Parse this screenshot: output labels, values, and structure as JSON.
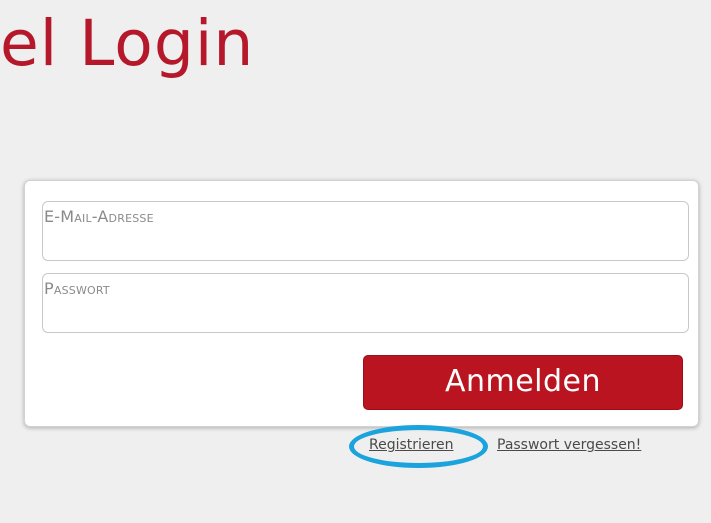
{
  "page": {
    "title": "el Login"
  },
  "form": {
    "email_placeholder": "E-Mail-Adresse",
    "password_placeholder": "Passwort",
    "submit_label": "Anmelden"
  },
  "links": {
    "register": "Registrieren",
    "forgot_password": "Passwort vergessen!"
  },
  "colors": {
    "brand": "#b5182a",
    "button": "#b9141f",
    "highlight": "#1aa3dd",
    "background": "#efefef"
  }
}
